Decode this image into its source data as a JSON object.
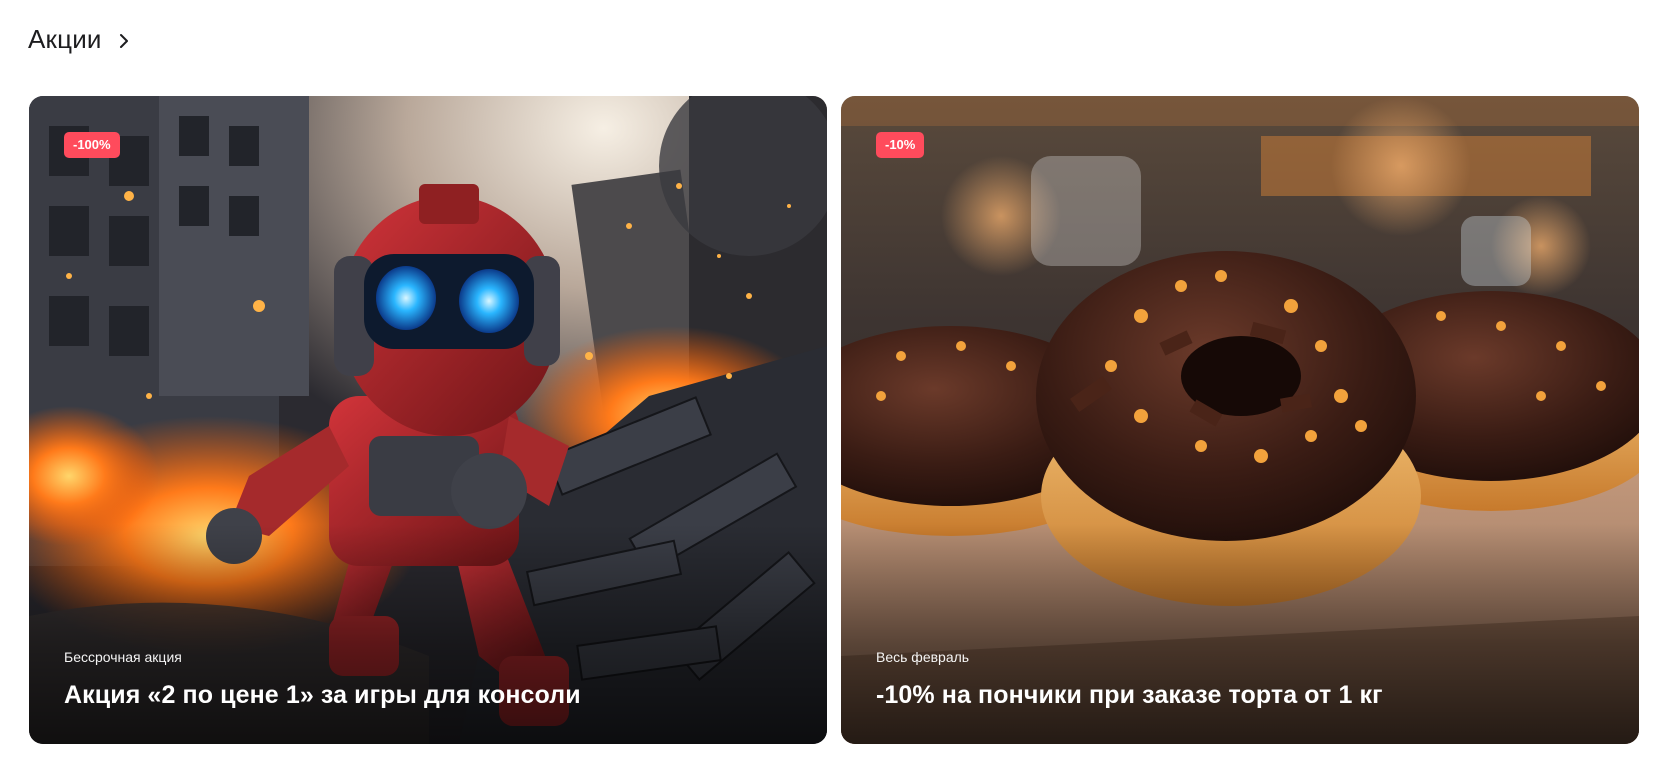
{
  "section": {
    "title": "Акции",
    "chevron_icon": "chevron-right-icon"
  },
  "promos": [
    {
      "badge": "-100%",
      "subtitle": "Бессрочная акция",
      "title": "Акция «2 по цене 1» за игры для консоли",
      "image": "robot-explosion-illustration"
    },
    {
      "badge": "-10%",
      "subtitle": "Весь февраль",
      "title": "-10% на пончики при заказе торта от 1 кг",
      "image": "chocolate-donuts-photo"
    }
  ],
  "colors": {
    "badge": "#ff4b5c",
    "text": "#1d1d1f",
    "background": "#ffffff"
  }
}
